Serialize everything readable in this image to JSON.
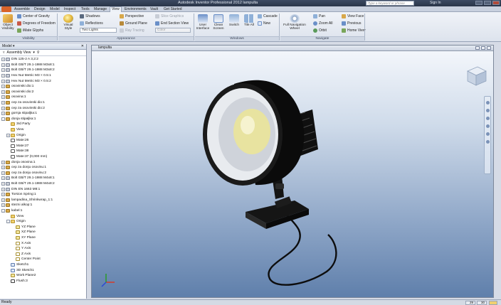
{
  "window": {
    "title": "Autodesk Inventor Professional 2012   lampulta",
    "search_placeholder": "Type a keyword or phrase",
    "sign_in": "Sign In"
  },
  "ribbon_tabs": [
    "Assemble",
    "Design",
    "Model",
    "Inspect",
    "Tools",
    "Manage",
    "View",
    "Environments",
    "Vault",
    "Get Started"
  ],
  "active_tab": "View",
  "ribbon": {
    "visibility": {
      "object_visibility": "Object Visibility",
      "center_of_gravity": "Center of Gravity",
      "degrees_of_freedom": "Degrees of Freedom",
      "ilogic_glyphs": "iMate Glyphs",
      "group_title": "Visibility"
    },
    "appearance": {
      "visual_style": "Visual Style",
      "shadows": "Shadows",
      "reflections": "Reflections",
      "lighting_value": "Two Lights",
      "perspective": "Perspective",
      "ground_plane": "Ground Plane",
      "ray_tracing": "Ray Tracing",
      "slice_graphics": "Slice Graphics",
      "end_section_view": "End Section View",
      "color_value": "Color",
      "group_title": "Appearance"
    },
    "windows": {
      "user_interface": "User Interface",
      "clean_screen": "Clean Screen",
      "switch": "Switch",
      "tile_all": "Tile All",
      "cascade": "Cascade",
      "new": "New",
      "group_title": "Windows"
    },
    "navigate": {
      "full_navigation_wheel": "Full Navigation Wheel",
      "pan": "Pan",
      "zoom_all": "Zoom All",
      "orbit": "Orbit",
      "view_face": "View Face",
      "previous": "Previous",
      "home_view": "Home View",
      "group_title": "Navigate"
    }
  },
  "browser": {
    "title": "Model",
    "view_selector": "Assembly View",
    "tree": [
      {
        "label": "DIN 125-2 A 3,2:2",
        "icon": "std",
        "indent": 0,
        "exp": "+"
      },
      {
        "label": "Bolt GB/T 29.1-1988 M3x8:1",
        "icon": "std",
        "indent": 0,
        "exp": "+"
      },
      {
        "label": "Bolt GB/T 29.1-1988 M3x8:2",
        "icon": "std",
        "indent": 0,
        "exp": "+"
      },
      {
        "label": "Hex Nut Metric M3 × 0.5:1",
        "icon": "std",
        "indent": 0,
        "exp": "+"
      },
      {
        "label": "Hex Nut Metric M3 × 0.5:2",
        "icon": "std",
        "indent": 0,
        "exp": "+"
      },
      {
        "label": "osovinski dio:1",
        "icon": "part",
        "indent": 0,
        "exp": "+"
      },
      {
        "label": "osovinski dio:2",
        "icon": "part",
        "indent": 0,
        "exp": "+"
      },
      {
        "label": "osovina:1",
        "icon": "part",
        "indent": 0,
        "exp": "+"
      },
      {
        "label": "cep za osovinski dio:1",
        "icon": "part",
        "indent": 0,
        "exp": "+"
      },
      {
        "label": "cep za osovinski dio:2",
        "icon": "part",
        "indent": 0,
        "exp": "+"
      },
      {
        "label": "gornja stipaljka:1",
        "icon": "part",
        "indent": 0,
        "exp": "+"
      },
      {
        "label": "donja stipaljka:1",
        "icon": "part",
        "indent": 0,
        "exp": "-"
      },
      {
        "label": "3rd Party",
        "icon": "folder",
        "indent": 1,
        "exp": ""
      },
      {
        "label": "View",
        "icon": "folder",
        "indent": 1,
        "exp": ""
      },
      {
        "label": "Origin",
        "icon": "folder",
        "indent": 1,
        "exp": "+"
      },
      {
        "label": "Mate:26",
        "icon": "mate",
        "indent": 1,
        "exp": ""
      },
      {
        "label": "Mate:27",
        "icon": "mate",
        "indent": 1,
        "exp": ""
      },
      {
        "label": "Mate:38",
        "icon": "mate",
        "indent": 1,
        "exp": ""
      },
      {
        "label": "Mate:37 (0,000 mm)",
        "icon": "mate",
        "indent": 1,
        "exp": ""
      },
      {
        "label": "donja osovina:1",
        "icon": "part",
        "indent": 0,
        "exp": "+"
      },
      {
        "label": "cep za donju osovinu:1",
        "icon": "part",
        "indent": 0,
        "exp": "+"
      },
      {
        "label": "cep za donju osovinu:2",
        "icon": "part",
        "indent": 0,
        "exp": "+"
      },
      {
        "label": "Bolt GB/T 29.1-1988 M4x8:1",
        "icon": "std",
        "indent": 0,
        "exp": "+"
      },
      {
        "label": "Bolt GB/T 29.1-1988 M4x8:2",
        "icon": "std",
        "indent": 0,
        "exp": "+"
      },
      {
        "label": "DIN EN 1663 M8:1",
        "icon": "std",
        "indent": 0,
        "exp": "+"
      },
      {
        "label": "Torsion Spring:1",
        "icon": "part",
        "indent": 0,
        "exp": "+"
      },
      {
        "label": "lampadina_Shrinkwrap_1:1",
        "icon": "part",
        "indent": 0,
        "exp": "+"
      },
      {
        "label": "stezni alkop:1",
        "icon": "part",
        "indent": 0,
        "exp": "+"
      },
      {
        "label": "kabel:1",
        "icon": "part",
        "indent": 0,
        "exp": "-"
      },
      {
        "label": "View",
        "icon": "folder",
        "indent": 1,
        "exp": ""
      },
      {
        "label": "Origin",
        "icon": "folder",
        "indent": 1,
        "exp": "-"
      },
      {
        "label": "YZ Plane",
        "icon": "plane",
        "indent": 2,
        "exp": ""
      },
      {
        "label": "XZ Plane",
        "icon": "plane",
        "indent": 2,
        "exp": ""
      },
      {
        "label": "XY Plane",
        "icon": "plane",
        "indent": 2,
        "exp": ""
      },
      {
        "label": "X Axis",
        "icon": "axis",
        "indent": 2,
        "exp": ""
      },
      {
        "label": "Y Axis",
        "icon": "axis",
        "indent": 2,
        "exp": ""
      },
      {
        "label": "Z Axis",
        "icon": "axis",
        "indent": 2,
        "exp": ""
      },
      {
        "label": "Center Point",
        "icon": "axis",
        "indent": 2,
        "exp": ""
      },
      {
        "label": "Sketch1",
        "icon": "sketch",
        "indent": 1,
        "exp": ""
      },
      {
        "label": "3D Sketch1",
        "icon": "sketch",
        "indent": 1,
        "exp": ""
      },
      {
        "label": "Work Plane2",
        "icon": "plane",
        "indent": 1,
        "exp": ""
      },
      {
        "label": "Flush:3",
        "icon": "flush",
        "indent": 1,
        "exp": ""
      }
    ]
  },
  "viewport": {
    "title": "lampulta"
  },
  "status": {
    "text": "Ready",
    "count1": "29",
    "count2": "30"
  },
  "colors": {
    "accent": "#d8632a",
    "lamp_body": "#111111",
    "bulb": "#e6e29a"
  }
}
